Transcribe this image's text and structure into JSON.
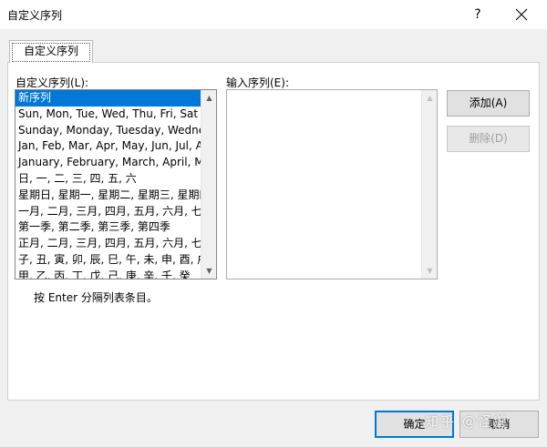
{
  "window": {
    "title": "自定义序列",
    "help_label": "?"
  },
  "tab": {
    "label": "自定义序列"
  },
  "custom_lists": {
    "label": "自定义序列(L):",
    "items": [
      "新序列",
      "Sun, Mon, Tue, Wed, Thu, Fri, Sat",
      "Sunday, Monday, Tuesday, Wednesday",
      "Jan, Feb, Mar, Apr, May, Jun, Jul, Aug",
      "January, February, March, April, May",
      "日, 一, 二, 三, 四, 五, 六",
      "星期日, 星期一, 星期二, 星期三, 星期四",
      "一月, 二月, 三月, 四月, 五月, 六月, 七月",
      "第一季, 第二季, 第三季, 第四季",
      "正月, 二月, 三月, 四月, 五月, 六月, 七月",
      "子, 丑, 寅, 卯, 辰, 巳, 午, 未, 申, 酉, 戌",
      "甲, 乙, 丙, 丁, 戊, 己, 庚, 辛, 壬, 癸"
    ],
    "selected_index": 0
  },
  "list_entries": {
    "label": "输入序列(E):",
    "value": ""
  },
  "buttons": {
    "add": "添加(A)",
    "delete": "删除(D)",
    "ok": "确定",
    "cancel": "取消"
  },
  "hint": "按 Enter 分隔列表条目。",
  "watermark": "知乎 @怪兽"
}
